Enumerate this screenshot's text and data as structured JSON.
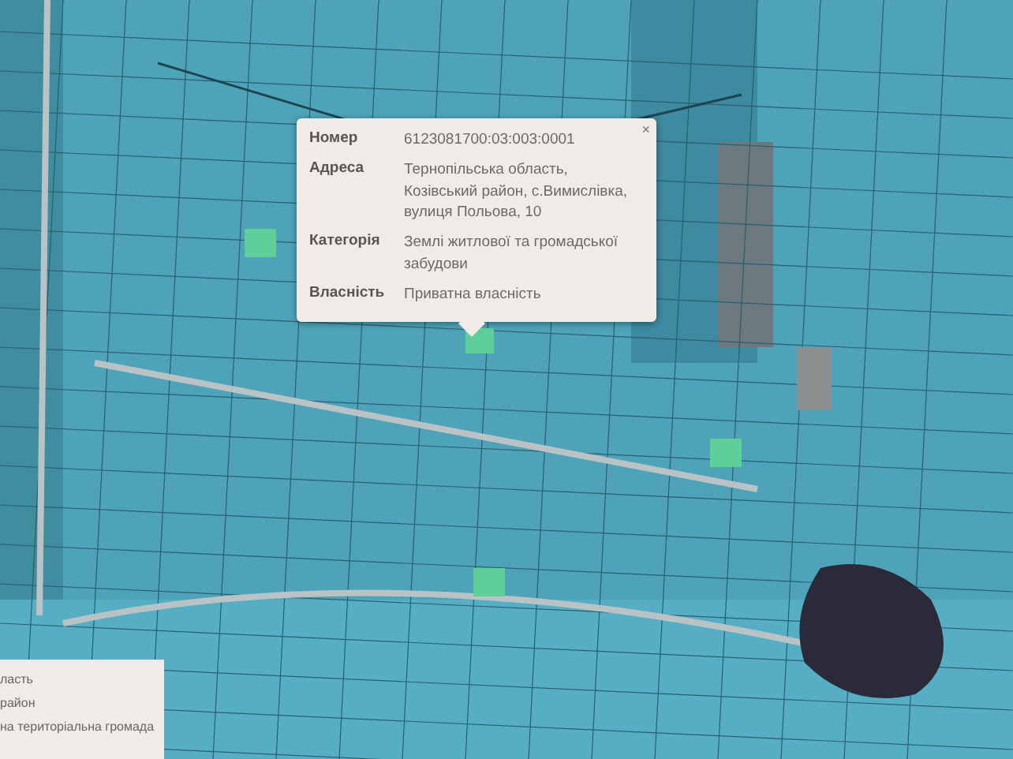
{
  "popup": {
    "close": "×",
    "rows": [
      {
        "label": "Номер",
        "value": "6123081700:03:003:0001"
      },
      {
        "label": "Адреса",
        "value": "Тернопільська область, Козівський район, с.Вимислівка, вулиця Польова, 10"
      },
      {
        "label": "Категорія",
        "value": "Землі житлової та громадської забудови"
      },
      {
        "label": "Власність",
        "value": "Приватна власність"
      }
    ]
  },
  "legend": {
    "items": [
      "ласть",
      "район",
      "на територіальна громада"
    ]
  }
}
